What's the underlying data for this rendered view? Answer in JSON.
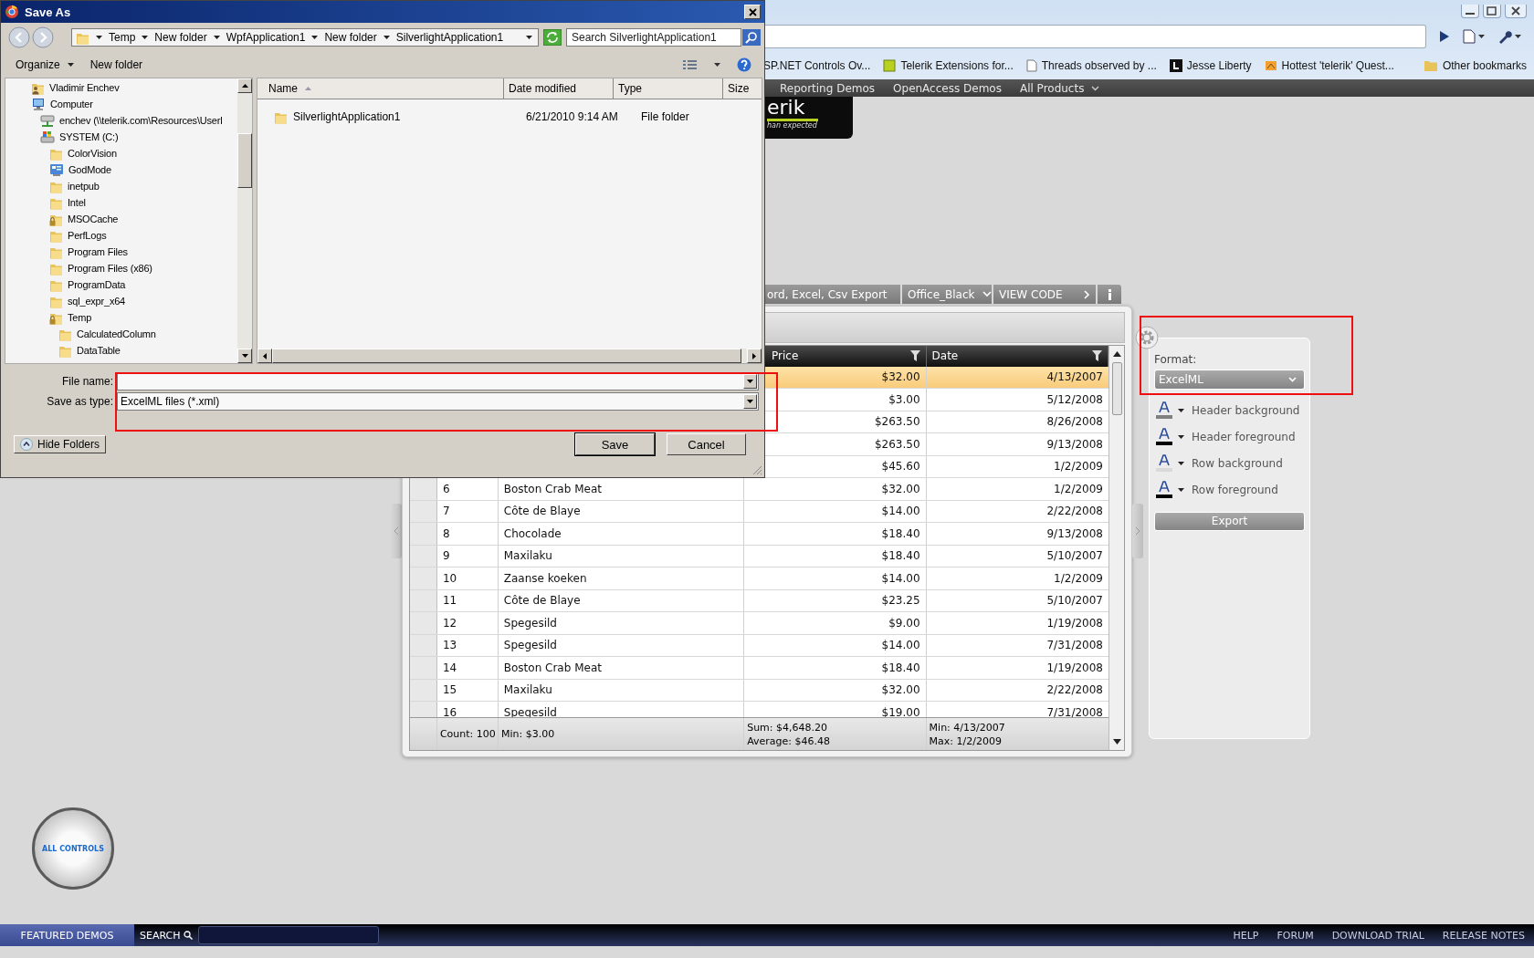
{
  "browser": {
    "bookmarks": [
      {
        "label": "SP.NET Controls Ov...",
        "kind": "page"
      },
      {
        "label": "Telerik Extensions for...",
        "kind": "extension"
      },
      {
        "label": "Threads observed by ...",
        "kind": "page"
      },
      {
        "label": "Jesse Liberty",
        "kind": "dark"
      },
      {
        "label": "Hottest 'telerik' Quest...",
        "kind": "feed"
      }
    ],
    "other_bookmarks": "Other bookmarks"
  },
  "site": {
    "nav": [
      {
        "label": "Reporting Demos",
        "dropdown": false
      },
      {
        "label": "OpenAccess Demos",
        "dropdown": false
      },
      {
        "label": "All Products",
        "dropdown": true
      }
    ],
    "logo": {
      "text": "erik",
      "tagline": "han expected"
    },
    "demo_tabs": [
      {
        "label": "ord, Excel, Csv Export",
        "kind": "tab"
      },
      {
        "label": "Office_Black",
        "kind": "dropdown"
      },
      {
        "label": "VIEW CODE",
        "kind": "link"
      },
      {
        "kind": "info"
      }
    ],
    "grid": {
      "columns": [
        {
          "label": "Price",
          "filter": true
        },
        {
          "label": "Date",
          "filter": true
        }
      ],
      "rows": [
        {
          "price": "$32.00",
          "date": "4/13/2007",
          "selected": true
        },
        {
          "price": "$3.00",
          "date": "5/12/2008",
          "selected": false
        },
        {
          "price": "$263.50",
          "date": "8/26/2008",
          "selected": false
        },
        {
          "price": "$263.50",
          "date": "9/13/2008",
          "selected": false
        },
        {
          "price": "$45.60",
          "date": "1/2/2009",
          "selected": false
        },
        {
          "id": "6",
          "name": "Boston Crab Meat",
          "price": "$32.00",
          "date": "1/2/2009",
          "selected": false
        },
        {
          "id": "7",
          "name": "Côte de Blaye",
          "price": "$14.00",
          "date": "2/22/2008",
          "selected": false
        },
        {
          "id": "8",
          "name": "Chocolade",
          "price": "$18.40",
          "date": "9/13/2008",
          "selected": false
        },
        {
          "id": "9",
          "name": "Maxilaku",
          "price": "$18.40",
          "date": "5/10/2007",
          "selected": false
        },
        {
          "id": "10",
          "name": "Zaanse koeken",
          "price": "$14.00",
          "date": "1/2/2009",
          "selected": false
        },
        {
          "id": "11",
          "name": "Côte de Blaye",
          "price": "$23.25",
          "date": "5/10/2007",
          "selected": false
        },
        {
          "id": "12",
          "name": "Spegesild",
          "price": "$9.00",
          "date": "1/19/2008",
          "selected": false
        },
        {
          "id": "13",
          "name": "Spegesild",
          "price": "$14.00",
          "date": "7/31/2008",
          "selected": false
        },
        {
          "id": "14",
          "name": "Boston Crab Meat",
          "price": "$18.40",
          "date": "1/19/2008",
          "selected": false
        },
        {
          "id": "15",
          "name": "Maxilaku",
          "price": "$32.00",
          "date": "2/22/2008",
          "selected": false
        },
        {
          "id": "16",
          "name": "Spegesild",
          "price": "$19.00",
          "date": "7/31/2008",
          "selected": false
        }
      ],
      "footer": {
        "count": "Count: 100",
        "min_name": "Min: $3.00",
        "price": [
          "Sum: $4,648.20",
          "Average: $46.48"
        ],
        "date": [
          "Min: 4/13/2007",
          "Max: 1/2/2009"
        ]
      }
    },
    "export_panel": {
      "format_label": "Format:",
      "format": "ExcelML",
      "colors": [
        {
          "label": "Header background",
          "color": "#808080"
        },
        {
          "label": "Header foreground",
          "color": "#000000"
        },
        {
          "label": "Row background",
          "color": "#d9d9d9"
        },
        {
          "label": "Row foreground",
          "color": "#000000"
        }
      ],
      "export": "Export"
    },
    "all_controls": "ALL CONTROLS",
    "footer": {
      "featured": "FEATURED DEMOS",
      "search": "SEARCH",
      "links": [
        "HELP",
        "FORUM",
        "DOWNLOAD TRIAL",
        "RELEASE NOTES"
      ]
    }
  },
  "dialog": {
    "title": "Save As",
    "breadcrumb": [
      "Temp",
      "New folder",
      "WpfApplication1",
      "New folder",
      "SilverlightApplication1"
    ],
    "search": {
      "placeholder": "Search SilverlightApplication1"
    },
    "toolbar": {
      "organize": "Organize",
      "new_folder": "New folder"
    },
    "tree": [
      {
        "label": "Vladimir Enchev",
        "kind": "user"
      },
      {
        "label": "Computer",
        "kind": "computer",
        "children": [
          {
            "label": "enchev (\\\\telerik.com\\Resources\\Userl",
            "kind": "network"
          },
          {
            "label": "SYSTEM (C:)",
            "kind": "drive",
            "children": [
              {
                "label": "ColorVision",
                "kind": "folder"
              },
              {
                "label": "GodMode",
                "kind": "panel"
              },
              {
                "label": "inetpub",
                "kind": "folder"
              },
              {
                "label": "Intel",
                "kind": "folder"
              },
              {
                "label": "MSOCache",
                "kind": "locked"
              },
              {
                "label": "PerfLogs",
                "kind": "folder"
              },
              {
                "label": "Program Files",
                "kind": "folder"
              },
              {
                "label": "Program Files (x86)",
                "kind": "folder"
              },
              {
                "label": "ProgramData",
                "kind": "folder"
              },
              {
                "label": "sql_expr_x64",
                "kind": "folder"
              },
              {
                "label": "Temp",
                "kind": "locked",
                "children": [
                  {
                    "label": "CalculatedColumn",
                    "kind": "folder"
                  },
                  {
                    "label": "DataTable",
                    "kind": "folder"
                  }
                ]
              }
            ]
          }
        ]
      }
    ],
    "columns": [
      {
        "label": "Name",
        "sorted": true
      },
      {
        "label": "Date modified",
        "sorted": false
      },
      {
        "label": "Type",
        "sorted": false
      },
      {
        "label": "Size",
        "sorted": false
      }
    ],
    "files": [
      {
        "name": "SilverlightApplication1",
        "date": "6/21/2010 9:14 AM",
        "type": "File folder"
      }
    ],
    "file_name": {
      "label": "File name:"
    },
    "save_type": {
      "label": "Save as type:",
      "value": "ExcelML files (*.xml)"
    },
    "hide_folders": "Hide Folders",
    "buttons": [
      {
        "label": "Save",
        "default": true
      },
      {
        "label": "Cancel",
        "default": false
      }
    ]
  },
  "highlights": {
    "file_fields": true,
    "format": true
  }
}
